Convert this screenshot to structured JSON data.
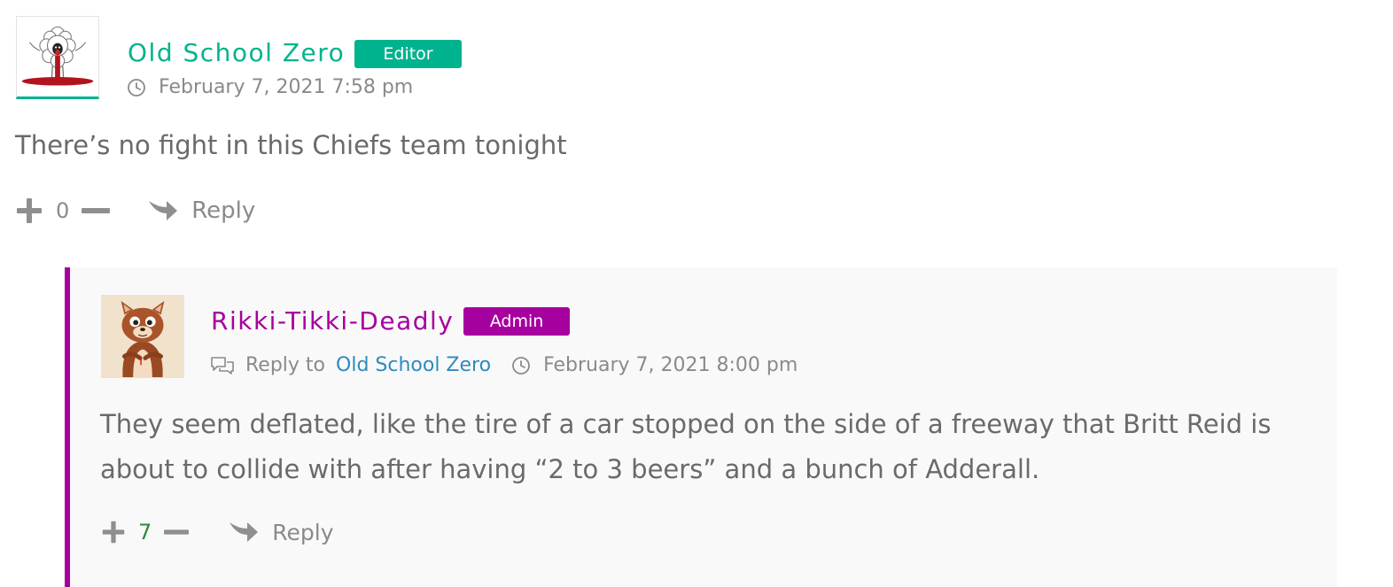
{
  "comments": [
    {
      "author": "Old School Zero",
      "badge": "Editor",
      "timestamp": "February 7, 2021 7:58 pm",
      "text": "There’s no fight in this Chiefs team tonight",
      "votes": "0",
      "reply_label": "Reply",
      "accent_color": "#00b38f",
      "avatar_icon": "sheep-cartoon-avatar"
    }
  ],
  "replies": [
    {
      "author": "Rikki-Tikki-Deadly",
      "badge": "Admin",
      "reply_to_label": "Reply to",
      "reply_to_author": "Old School Zero",
      "timestamp": "February 7, 2021 8:00 pm",
      "text": "They seem deflated, like the tire of a car stopped on the side of a freeway that Britt Reid is about to collide with after having “2 to 3 beers” and a bunch of Adderall.",
      "votes": "7",
      "reply_label": "Reply",
      "accent_color": "#a6009e",
      "avatar_icon": "mongoose-cartoon-avatar"
    }
  ],
  "colors": {
    "editor": "#00b38f",
    "admin": "#a6009e",
    "link": "#2d8bbd",
    "positive_votes": "#2a8a3e",
    "meta_text": "#8a8a8a",
    "reply_background": "#f9f9f9"
  },
  "icons": {
    "clock": "clock-icon",
    "chat": "chat-bubbles-icon",
    "upvote": "plus-icon",
    "downvote": "minus-icon",
    "reply": "reply-arrow-icon"
  }
}
